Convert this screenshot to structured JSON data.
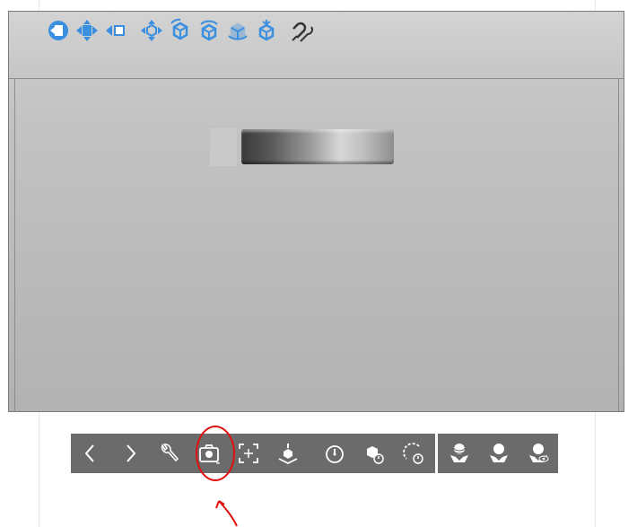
{
  "window": {
    "view_toolbar": {
      "icons": [
        "view-left-icon",
        "view-center-icon",
        "view-right-icon",
        "pan-icon",
        "view-iso-1-icon",
        "view-iso-2-icon",
        "view-iso-3-icon",
        "view-iso-4-icon",
        "magnet-snap-icon"
      ]
    }
  },
  "bottom_toolbar": {
    "groups": [
      [
        "back-icon",
        "forward-icon",
        "wrench-icon",
        "camera-icon",
        "frame-icon",
        "place-icon",
        "clock-icon",
        "cube-clock-icon",
        "rotate-clock-icon"
      ],
      [
        "hand-sphere-icon",
        "hand-drop-icon",
        "hand-eye-icon"
      ]
    ],
    "highlighted": "camera-icon"
  },
  "colors": {
    "icon_blue": "#3a8fe0",
    "toolbar_bg": "#6b6b6b",
    "annotation_red": "#e01010"
  }
}
